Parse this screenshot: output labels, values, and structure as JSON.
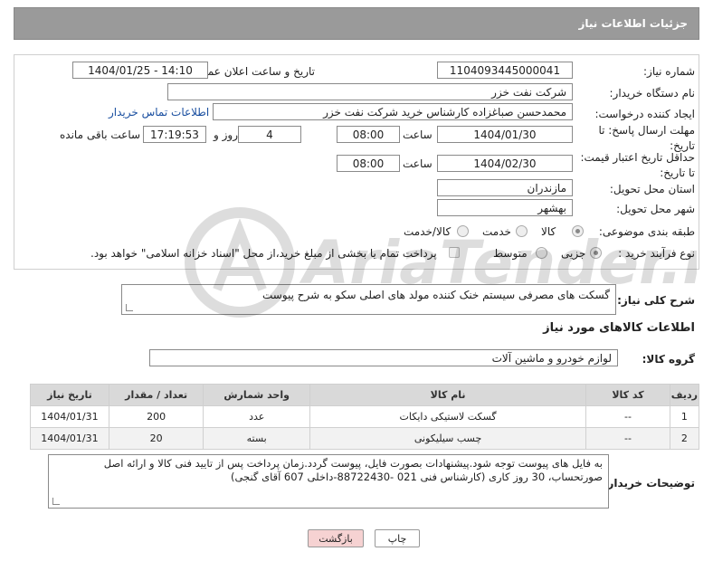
{
  "header": {
    "title": "جزئیات اطلاعات نیاز"
  },
  "form": {
    "need_number_label": "شماره نیاز:",
    "need_number": "1104093445000041",
    "announce_label": "تاریخ و ساعت اعلان عمومی:",
    "announce_value": "1404/01/25 - 14:10",
    "buyer_org_label": "نام دستگاه خریدار:",
    "buyer_org": "شرکت نفت خزر",
    "requester_label": "ایجاد کننده درخواست:",
    "requester": "محمدحسن صباغزاده کارشناس خرید شرکت نفت خزر",
    "contact_link": "اطلاعات تماس خریدار",
    "deadline_label_1": "مهلت ارسال پاسخ: تا",
    "deadline_label_2": "تاریخ:",
    "deadline_date": "1404/01/30",
    "time_label": "ساعت",
    "deadline_time": "08:00",
    "days": "4",
    "days_label": "روز و",
    "remaining_time": "17:19:53",
    "remaining_label": "ساعت باقی مانده",
    "validity_label_1": "حداقل تاریخ اعتبار قیمت:",
    "validity_label_2": "تا تاریخ:",
    "validity_date": "1404/02/30",
    "validity_time": "08:00",
    "province_label": "استان محل تحویل:",
    "province": "مازندران",
    "city_label": "شهر محل تحویل:",
    "city": "بهشهر",
    "category_label": "طبقه بندی موضوعی:",
    "category_options": [
      "کالا",
      "خدمت",
      "کالا/خدمت"
    ],
    "category_selected": "کالا",
    "process_label": "نوع فرآیند خرید :",
    "process_options": [
      "جزیی",
      "متوسط"
    ],
    "process_selected": "جزیی",
    "payment_note": "پرداخت تمام یا بخشی از مبلغ خرید،از محل \"اسناد خزانه اسلامی\" خواهد بود."
  },
  "general_desc": {
    "label": "شرح کلی نیاز:",
    "value": "گسکت های مصرفی سیستم خنک کننده مولد های اصلی سکو به شرح پیوست"
  },
  "goods_section": {
    "title": "اطلاعات کالاهای مورد نیاز",
    "group_label": "گروه کالا:",
    "group_value": "لوازم خودرو و ماشین آلات"
  },
  "table": {
    "headers": [
      "ردیف",
      "کد کالا",
      "نام کالا",
      "واحد شمارش",
      "تعداد / مقدار",
      "تاریخ نیاز"
    ],
    "rows": [
      [
        "1",
        "--",
        "گسکت لاستیکی دایکات",
        "عدد",
        "200",
        "1404/01/31"
      ],
      [
        "2",
        "--",
        "چسب سیلیکونی",
        "بسته",
        "20",
        "1404/01/31"
      ]
    ]
  },
  "buyer_notes": {
    "label": "توضیحات خریدار:",
    "line1": "به فایل های پیوست توجه شود.پیشنهادات  بصورت فایل، پیوست گردد.زمان پرداخت پس از تایید فنی کالا و ارائه اصل",
    "line2": "صورتحساب، 30 روز کاری  (کارشناس فنی 021 -88722430-داخلی 607 آقای گنجی)"
  },
  "buttons": {
    "print": "چاپ",
    "back": "بازگشت"
  },
  "watermark": {
    "text": "AriaTender.net"
  },
  "colors": {
    "header_bg": "#9a9a9a",
    "table_header_bg": "#d9d9d9",
    "link": "#1a4fa0",
    "back_button_bg": "#f6d2d2",
    "print_button_bg": "#ffffff"
  }
}
